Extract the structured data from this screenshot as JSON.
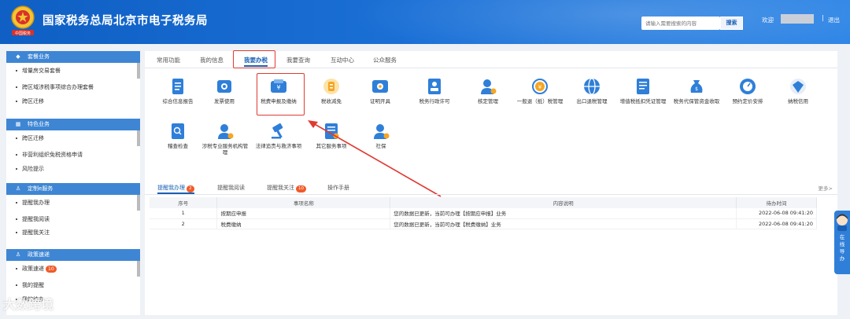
{
  "header": {
    "title": "国家税务总局北京市电子税务局",
    "emblem_text": "中国税务",
    "search_placeholder": "请输入需要搜索的内容",
    "search_button": "搜索",
    "welcome": "欢迎",
    "separator": "|",
    "logout": "退出"
  },
  "sidebar": {
    "sections": [
      {
        "title": "套餐业务",
        "icon": "package-icon",
        "items": [
          "增量房交易套餐",
          "跨区域涉税事项综合办理套餐",
          "跨区迁移"
        ]
      },
      {
        "title": "特色业务",
        "icon": "grid-icon",
        "items": [
          "跨区迁移",
          "非营利组织免税资格申请",
          "风险提示"
        ]
      },
      {
        "title": "定制e服务",
        "icon": "user-icon",
        "items": [
          "提醒我办理",
          "提醒我阅读",
          "提醒我关注"
        ]
      },
      {
        "title": "政策速递",
        "icon": "user-icon",
        "items": [
          "政策速递",
          "我的提醒",
          "我的待办"
        ],
        "badge": "10"
      }
    ]
  },
  "main": {
    "tabs": [
      "常用功能",
      "我的信息",
      "我要办税",
      "我要查询",
      "互动中心",
      "公众服务"
    ],
    "active_tab": "我要办税",
    "tiles": [
      {
        "label": "综合信息报告",
        "icon": "report-icon",
        "color": "#2f7fd8"
      },
      {
        "label": "发票使用",
        "icon": "invoice-icon",
        "color": "#2f7fd8"
      },
      {
        "label": "税费申报及缴纳",
        "icon": "tax-payment-icon",
        "color": "#2f7fd8"
      },
      {
        "label": "税收减免",
        "icon": "tax-reduction-icon",
        "color": "#f5a623"
      },
      {
        "label": "证明开具",
        "icon": "certificate-icon",
        "color": "#2f7fd8"
      },
      {
        "label": "税务行政许可",
        "icon": "license-icon",
        "color": "#2f7fd8"
      },
      {
        "label": "核定管理",
        "icon": "verify-icon",
        "color": "#2f7fd8"
      },
      {
        "label": "一般退（抵）税管理",
        "icon": "refund-icon",
        "color": "#f5a623"
      },
      {
        "label": "出口退税管理",
        "icon": "export-icon",
        "color": "#2f7fd8"
      },
      {
        "label": "增值税抵扣凭证管理",
        "icon": "voucher-icon",
        "color": "#2f7fd8"
      },
      {
        "label": "税务代保管资金收取",
        "icon": "money-bag-icon",
        "color": "#2f7fd8"
      },
      {
        "label": "预约定价安排",
        "icon": "pricing-icon",
        "color": "#2f7fd8"
      },
      {
        "label": "纳税信用",
        "icon": "credit-icon",
        "color": "#2f7fd8"
      },
      {
        "label": "稽查检查",
        "icon": "inspection-icon",
        "color": "#2f7fd8"
      },
      {
        "label": "涉税专业服务机构管理",
        "icon": "agency-icon",
        "color": "#2f7fd8"
      },
      {
        "label": "法律追责与救济事项",
        "icon": "legal-icon",
        "color": "#2f7fd8"
      },
      {
        "label": "其它服务事项",
        "icon": "other-service-icon",
        "color": "#2f7fd8"
      },
      {
        "label": "社保",
        "icon": "social-security-icon",
        "color": "#2f7fd8"
      }
    ],
    "bottom_tabs": [
      {
        "label": "提醒我办理",
        "badge": "2"
      },
      {
        "label": "提醒我阅读",
        "badge": ""
      },
      {
        "label": "提醒我关注",
        "badge": "10"
      },
      {
        "label": "操作手册",
        "badge": ""
      }
    ],
    "more": "更多>",
    "table": {
      "headers": [
        "序号",
        "事项名称",
        "内容说明",
        "待办时间"
      ],
      "rows": [
        [
          "1",
          "按期应申报",
          "您的数据已更新，当前可办理【按期应申报】业务",
          "2022-06-08 09:41:20"
        ],
        [
          "2",
          "税费缴纳",
          "您的数据已更新，当前可办理【税费缴纳】业务",
          "2022-06-08 09:41:20"
        ]
      ]
    }
  },
  "side_help": {
    "text": "在线导办"
  },
  "watermark": "大数跨境",
  "colors": {
    "brand_blue": "#1a5fb4",
    "sidebar_head": "#3e86d4",
    "highlight_red": "#e03a32",
    "badge_orange": "#f05a28"
  }
}
